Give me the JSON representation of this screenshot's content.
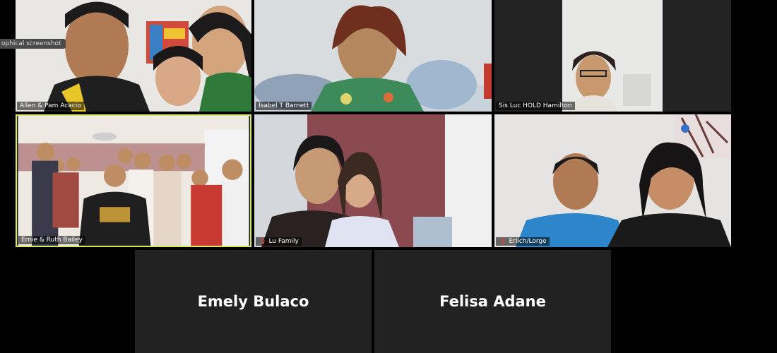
{
  "overlay_tag": "ophical screenshot",
  "tiles": [
    {
      "name": "Allen & Pam Acacio",
      "muted": false
    },
    {
      "name": "Isabel T Barnett",
      "muted": false
    },
    {
      "name": "Sis Luc   HOLD Hamilton",
      "muted": false
    },
    {
      "name": "Ernie & Ruth Bailey",
      "muted": false
    },
    {
      "name": "Lu Family",
      "muted": true
    },
    {
      "name": "Erlich/Lorge",
      "muted": true
    }
  ],
  "name_tiles": [
    {
      "name": "Emely Bulaco"
    },
    {
      "name": "Felisa Adane"
    }
  ],
  "colors": {
    "active_speaker_border": "#d8e96a",
    "muted_icon": "#e0433a"
  }
}
